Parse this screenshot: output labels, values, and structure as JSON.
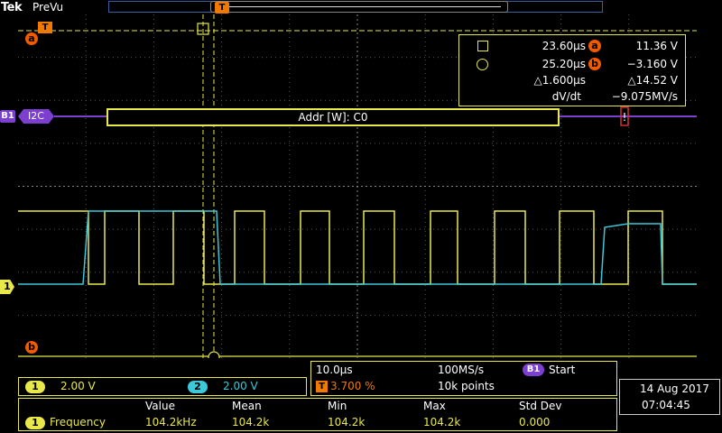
{
  "header": {
    "brand": "Tek",
    "mode": "PreVu"
  },
  "markers": {
    "trigger": "T",
    "a": "a",
    "b": "b",
    "ch1": "1",
    "ch2": "2",
    "bus": "B1"
  },
  "bus": {
    "protocol": "I2C",
    "decode": "Addr [W]: C0",
    "warning": "!"
  },
  "cursor_readout": {
    "cursor1_time": "23.60µs",
    "cursor1_volt": "11.36 V",
    "cursor2_time": "25.20µs",
    "cursor2_volt": "−3.160 V",
    "delta_time": "△1.600µs",
    "delta_volt": "△14.52 V",
    "dvdt_label": "dV/dt",
    "dvdt_value": "−9.075MV/s"
  },
  "channels": {
    "ch1": {
      "scale": "2.00 V",
      "color": "#e8e84a"
    },
    "ch2": {
      "scale": "2.00 V",
      "color": "#3cc8d8"
    }
  },
  "horizontal": {
    "timebase": "10.0µs",
    "sample_rate": "100MS/s",
    "trigger_pos": "3.700 %",
    "points": "10k points"
  },
  "acquisition": {
    "state": "Start"
  },
  "measurement": {
    "headers": [
      "Value",
      "Mean",
      "Min",
      "Max",
      "Std Dev"
    ],
    "label": "Frequency",
    "values": [
      "104.2kHz",
      "104.2k",
      "104.2k",
      "104.2k",
      "0.000"
    ]
  },
  "datetime": {
    "date": "14 Aug 2017",
    "time": "07:04:45"
  },
  "colors": {
    "accent": "#e8e84a",
    "bus": "#7c3fd0",
    "marker": "#f05a00",
    "ch2": "#3cc8d8"
  }
}
